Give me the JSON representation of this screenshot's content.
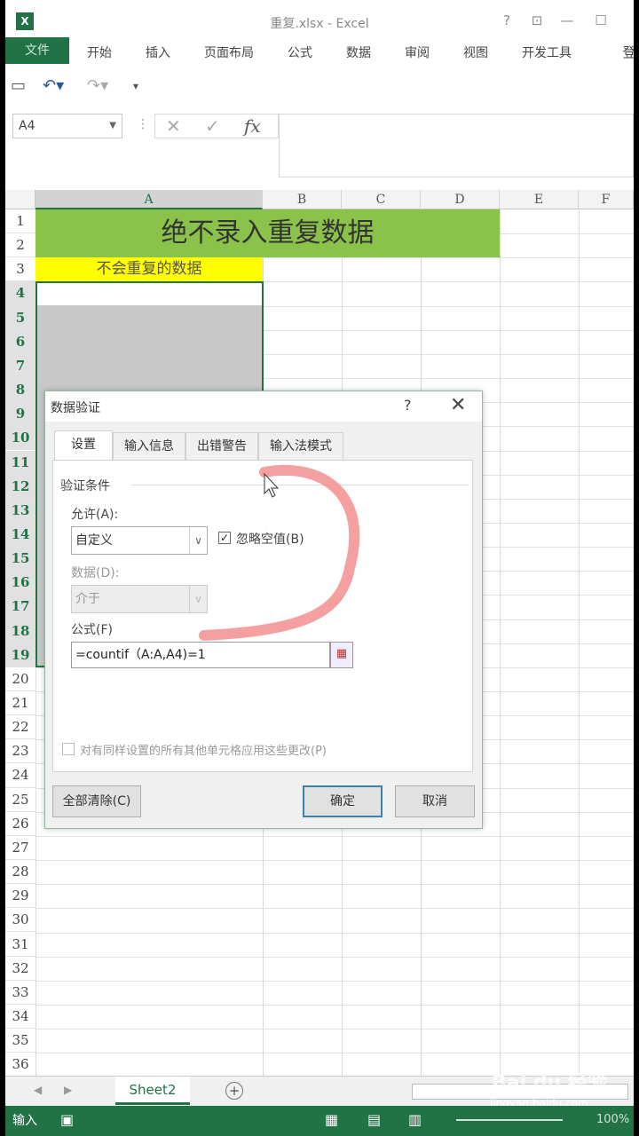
{
  "window": {
    "title": "重复.xlsx - Excel",
    "controls": {
      "help": "?",
      "ribbon_opts": "⊡",
      "minimize": "—",
      "maximize": "☐",
      "signin": "登"
    }
  },
  "ribbon": {
    "file": "文件",
    "tabs": [
      "开始",
      "插入",
      "页面布局",
      "公式",
      "数据",
      "审阅",
      "视图",
      "开发工具"
    ]
  },
  "formula_bar": {
    "name_box": "A4",
    "fx": "fx",
    "value": ""
  },
  "columns": [
    "A",
    "B",
    "C",
    "D",
    "E",
    "F"
  ],
  "rows": [
    "1",
    "2",
    "3",
    "4",
    "5",
    "6",
    "7",
    "8",
    "9",
    "10",
    "11",
    "12",
    "13",
    "14",
    "15",
    "16",
    "17",
    "18",
    "19",
    "20",
    "21",
    "22",
    "23",
    "24",
    "25",
    "26",
    "27",
    "28",
    "29",
    "30",
    "31",
    "32",
    "33",
    "34",
    "35",
    "36"
  ],
  "cells": {
    "title": "绝不录入重复数据",
    "subtitle": "不会重复的数据"
  },
  "dialog": {
    "title": "数据验证",
    "help": "?",
    "close": "✕",
    "tabs": [
      "设置",
      "输入信息",
      "出错警告",
      "输入法模式"
    ],
    "section": "验证条件",
    "allow_label": "允许(A):",
    "allow_value": "自定义",
    "ignore_blank": "忽略空值(B)",
    "data_label": "数据(D):",
    "data_value": "介于",
    "formula_label": "公式(F)",
    "formula_value": "=countif（A:A,A4)=1",
    "apply_all": "对有同样设置的所有其他单元格应用这些更改(P)",
    "clear_all": "全部清除(C)",
    "ok": "确定",
    "cancel": "取消"
  },
  "sheets": {
    "active": "Sheet2"
  },
  "status": {
    "mode": "输入",
    "zoom": "100%"
  },
  "watermark": {
    "brand": "Bai du 经验",
    "url": "jingyan.baidu.com"
  },
  "colors": {
    "excel_green": "#217346",
    "title_fill": "#8bc24a",
    "subtitle_fill": "#ffff00"
  }
}
